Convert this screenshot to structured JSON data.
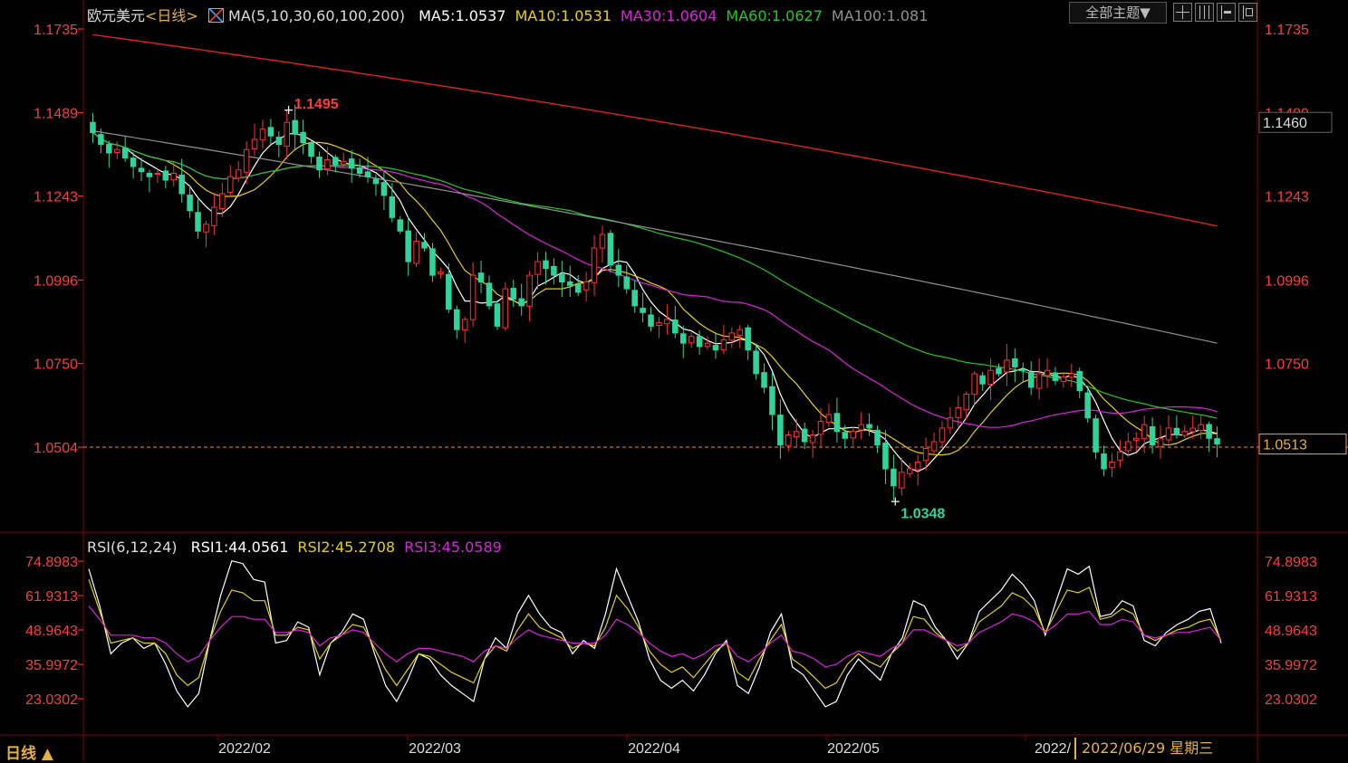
{
  "header": {
    "symbol": "欧元美元",
    "period": "<日线>",
    "ma_label": "MA(5,10,30,60,100,200)",
    "ma_values": [
      {
        "text": "MA5:1.0537",
        "color": "#ffffff"
      },
      {
        "text": "MA10:1.0531",
        "color": "#e6d200"
      },
      {
        "text": "MA30:1.0604",
        "color": "#e020e0"
      },
      {
        "text": "MA60:1.0627",
        "color": "#22c922"
      },
      {
        "text": "MA100:1.081",
        "color": "#909090"
      }
    ],
    "theme_button": "全部主题▼",
    "toolbar_icons": [
      "grid-icon",
      "layout-icon",
      "panel-icon",
      "fullscreen-icon"
    ]
  },
  "rsi_header": {
    "label": "RSI(6,12,24)",
    "values": [
      {
        "text": "RSI1:44.0561",
        "color": "#ffffff"
      },
      {
        "text": "RSI2:45.2708",
        "color": "#e6d200"
      },
      {
        "text": "RSI3:45.0589",
        "color": "#e020e0"
      }
    ]
  },
  "footer": {
    "period_label": "日线 ▲",
    "date_ticks": [
      "2022/02",
      "2022/03",
      "2022/04",
      "2022/05",
      "2022/"
    ],
    "cursor_date": "2022/06/29 星期三"
  },
  "colors": {
    "up": "#ff3030",
    "down": "#2fd49a",
    "axis": "#ff3b3b",
    "grid": "#8b0000",
    "cursor": "#ff8c00"
  },
  "chart_data": [
    {
      "type": "candlestick",
      "title": "欧元美元 日线",
      "y_ticks": [
        "1.1735",
        "1.1489",
        "1.1243",
        "1.0996",
        "1.0750",
        "1.0504"
      ],
      "ylim": [
        1.029,
        1.1735
      ],
      "current_price": "1.0513",
      "cursor_price": "1.0504",
      "highlight_price": "1.1460",
      "annotations": [
        {
          "text": "1.1495",
          "value": 1.1495
        },
        {
          "text": "1.0348",
          "value": 1.0348
        }
      ],
      "close": [
        1.143,
        1.1395,
        1.137,
        1.138,
        1.1355,
        1.133,
        1.1315,
        1.13,
        1.131,
        1.129,
        1.131,
        1.125,
        1.12,
        1.114,
        1.116,
        1.121,
        1.125,
        1.13,
        1.132,
        1.138,
        1.141,
        1.144,
        1.142,
        1.1395,
        1.146,
        1.1425,
        1.14,
        1.136,
        1.132,
        1.135,
        1.1335,
        1.1345,
        1.1325,
        1.131,
        1.13,
        1.128,
        1.1245,
        1.118,
        1.114,
        1.105,
        1.111,
        1.109,
        1.101,
        1.102,
        1.091,
        1.085,
        1.088,
        1.101,
        1.099,
        1.092,
        1.086,
        1.097,
        1.094,
        1.092,
        1.101,
        1.105,
        1.103,
        1.101,
        1.099,
        1.098,
        1.096,
        1.099,
        1.109,
        1.113,
        1.104,
        1.101,
        1.097,
        1.092,
        1.09,
        1.086,
        1.087,
        1.088,
        1.084,
        1.081,
        1.083,
        1.08,
        1.081,
        1.079,
        1.082,
        1.084,
        1.085,
        1.079,
        1.072,
        1.068,
        1.06,
        1.051,
        1.054,
        1.055,
        1.052,
        1.054,
        1.058,
        1.06,
        1.055,
        1.053,
        1.055,
        1.057,
        1.056,
        1.051,
        1.044,
        1.039,
        1.043,
        1.044,
        1.046,
        1.05,
        1.052,
        1.056,
        1.059,
        1.062,
        1.066,
        1.072,
        1.069,
        1.073,
        1.072,
        1.076,
        1.074,
        1.073,
        1.068,
        1.072,
        1.073,
        1.07,
        1.071,
        1.072,
        1.067,
        1.059,
        1.049,
        1.044,
        1.046,
        1.049,
        1.052,
        1.053,
        1.057,
        1.051,
        1.053,
        1.056,
        1.054,
        1.055,
        1.056,
        1.057,
        1.053,
        1.0513
      ],
      "ma_periods": [
        5,
        10,
        30,
        60,
        100,
        200
      ],
      "ma_endpoints": {
        "ma5": 1.0537,
        "ma10": 1.0531,
        "ma30": 1.0604,
        "ma60": 1.0627,
        "ma100": 1.081
      }
    },
    {
      "type": "line",
      "title": "RSI(6,12,24)",
      "y_ticks": [
        "74.8983",
        "61.9313",
        "48.9643",
        "35.9972",
        "23.0302"
      ],
      "ylim": [
        15,
        80
      ],
      "series": [
        {
          "name": "RSI1",
          "values": [
            72,
            58,
            40,
            44,
            46,
            42,
            44,
            36,
            26,
            20,
            25,
            45,
            62,
            75,
            74,
            68,
            67,
            44,
            45,
            52,
            50,
            32,
            44,
            48,
            55,
            53,
            40,
            28,
            22,
            30,
            40,
            38,
            32,
            28,
            25,
            22,
            38,
            46,
            42,
            55,
            62,
            55,
            50,
            48,
            40,
            45,
            42,
            55,
            72,
            62,
            52,
            38,
            30,
            27,
            30,
            26,
            32,
            40,
            45,
            28,
            25,
            35,
            48,
            55,
            35,
            32,
            26,
            20,
            22,
            32,
            38,
            34,
            30,
            40,
            46,
            60,
            58,
            50,
            45,
            38,
            44,
            56,
            60,
            64,
            70,
            66,
            60,
            47,
            60,
            72,
            70,
            73,
            54,
            55,
            60,
            58,
            45,
            43,
            48,
            51,
            53,
            56,
            57,
            44
          ]
        },
        {
          "name": "RSI2",
          "values": [
            68,
            56,
            44,
            45,
            46,
            44,
            44,
            40,
            32,
            28,
            31,
            45,
            56,
            64,
            63,
            60,
            60,
            47,
            47,
            50,
            49,
            38,
            44,
            47,
            51,
            50,
            42,
            34,
            28,
            34,
            40,
            39,
            36,
            33,
            31,
            29,
            38,
            43,
            41,
            49,
            55,
            50,
            48,
            46,
            42,
            44,
            43,
            50,
            62,
            57,
            50,
            41,
            36,
            33,
            35,
            31,
            36,
            41,
            44,
            33,
            30,
            38,
            45,
            51,
            38,
            35,
            31,
            27,
            29,
            36,
            40,
            37,
            35,
            40,
            44,
            54,
            53,
            48,
            45,
            41,
            44,
            52,
            55,
            58,
            63,
            61,
            57,
            48,
            56,
            64,
            63,
            65,
            53,
            54,
            57,
            55,
            47,
            45,
            47,
            49,
            50,
            52,
            53,
            45
          ]
        },
        {
          "name": "RSI3",
          "values": [
            58,
            53,
            47,
            47,
            47,
            46,
            46,
            44,
            40,
            37,
            39,
            45,
            50,
            54,
            54,
            53,
            53,
            48,
            48,
            49,
            48,
            43,
            46,
            47,
            49,
            48,
            44,
            40,
            37,
            40,
            42,
            42,
            41,
            40,
            39,
            37,
            41,
            43,
            42,
            46,
            49,
            47,
            46,
            45,
            44,
            44,
            44,
            47,
            53,
            51,
            48,
            44,
            41,
            39,
            40,
            38,
            40,
            43,
            44,
            39,
            37,
            40,
            44,
            47,
            41,
            40,
            38,
            35,
            36,
            39,
            41,
            40,
            39,
            42,
            44,
            49,
            49,
            47,
            45,
            43,
            44,
            48,
            50,
            52,
            55,
            54,
            52,
            48,
            51,
            55,
            55,
            56,
            51,
            51,
            53,
            52,
            47,
            46,
            47,
            48,
            48,
            49,
            50,
            45
          ]
        }
      ]
    }
  ]
}
